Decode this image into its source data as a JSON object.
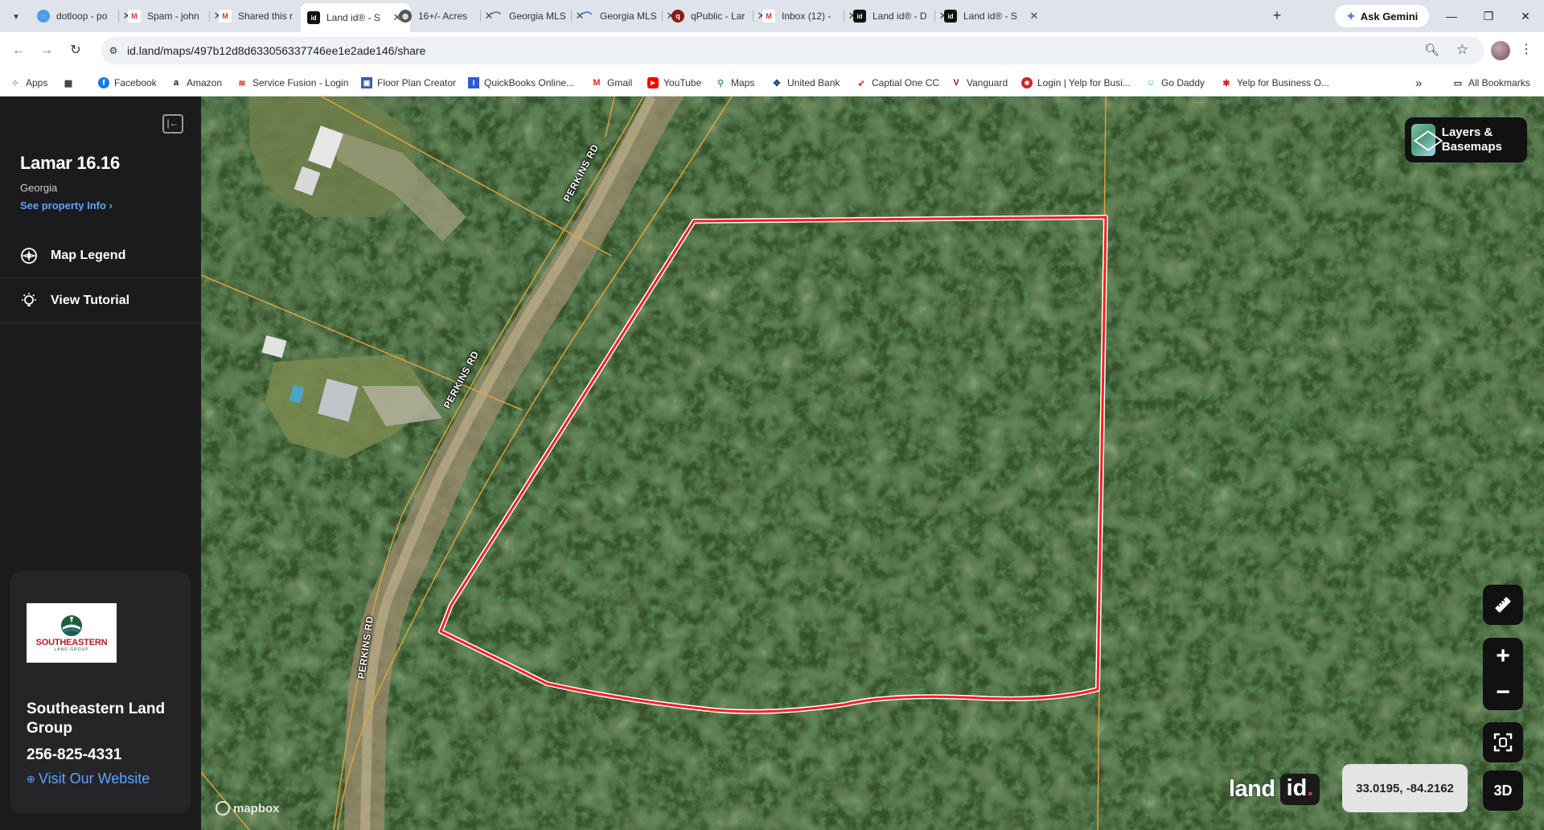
{
  "browser": {
    "tabs": [
      {
        "title": "dotloop - po",
        "favicon": "dotloop-icon",
        "color": "#4d9be8",
        "active": false
      },
      {
        "title": "Spam - john",
        "favicon": "gmail-icon",
        "color": "#d93025",
        "active": false
      },
      {
        "title": "Shared this r",
        "favicon": "gmail-icon",
        "color": "#d93025",
        "active": false
      },
      {
        "title": "Land id® - S",
        "favicon": "landid-icon",
        "color": "#111111",
        "active": true
      },
      {
        "title": "16+/- Acres",
        "favicon": "globe-icon",
        "color": "#555555",
        "active": false
      },
      {
        "title": "Georgia MLS",
        "favicon": "gamls-icon",
        "color": "#2a6cb3",
        "active": false
      },
      {
        "title": "Georgia MLS",
        "favicon": "gamls-icon",
        "color": "#2a6cb3",
        "active": false
      },
      {
        "title": "qPublic - Lar",
        "favicon": "qpublic-icon",
        "color": "#8b1b1b",
        "active": false
      },
      {
        "title": "Inbox (12) - ",
        "favicon": "gmail-icon",
        "color": "#d93025",
        "active": false
      },
      {
        "title": "Land id® - D",
        "favicon": "landid-icon",
        "color": "#111111",
        "active": false
      },
      {
        "title": "Land id® - S",
        "favicon": "landid-icon",
        "color": "#111111",
        "active": false
      }
    ],
    "new_tab_label": "+",
    "ask_gemini_label": "Ask Gemini",
    "url": "id.land/maps/497b12d8d633056337746ee1e2ade146/share",
    "bookmarks": [
      {
        "label": "Apps",
        "icon": "apps-grid-icon",
        "color": "#4285f4"
      },
      {
        "label": "",
        "icon": "apps-launcher-icon",
        "color": "#333333"
      },
      {
        "label": "Facebook",
        "icon": "facebook-icon",
        "color": "#1877f2"
      },
      {
        "label": "Amazon",
        "icon": "amazon-icon",
        "color": "#111111"
      },
      {
        "label": "Service Fusion - Login",
        "icon": "servicefusion-icon",
        "color": "#d9281f"
      },
      {
        "label": "Floor Plan Creator",
        "icon": "floorplan-icon",
        "color": "#3a5fa8"
      },
      {
        "label": "QuickBooks Online...",
        "icon": "quickbooks-icon",
        "color": "#2a5bd7"
      },
      {
        "label": "Gmail",
        "icon": "gmail-icon",
        "color": "#d93025"
      },
      {
        "label": "YouTube",
        "icon": "youtube-icon",
        "color": "#ff0000"
      },
      {
        "label": "Maps",
        "icon": "maps-pin-icon",
        "color": "#34a853"
      },
      {
        "label": "United Bank",
        "icon": "unitedbank-icon",
        "color": "#1c3f73"
      },
      {
        "label": "Captial One CC",
        "icon": "capitalone-icon",
        "color": "#d22e1e"
      },
      {
        "label": "Vanguard",
        "icon": "vanguard-icon",
        "color": "#96151d"
      },
      {
        "label": "Login | Yelp for Busi...",
        "icon": "yelp-icon",
        "color": "#d32323"
      },
      {
        "label": "Go Daddy",
        "icon": "godaddy-icon",
        "color": "#1bdbdb"
      },
      {
        "label": "Yelp for Business O...",
        "icon": "yelp-icon",
        "color": "#d32323"
      }
    ],
    "overflow_label": "»",
    "all_bookmarks_label": "All Bookmarks"
  },
  "sidebar": {
    "property_title": "Lamar 16.16",
    "state": "Georgia",
    "property_info_link": "See property Info  ›",
    "menu": [
      {
        "label": "Map Legend",
        "icon": "compass-icon"
      },
      {
        "label": "View Tutorial",
        "icon": "lightbulb-icon"
      }
    ],
    "agent": {
      "logo_name": "SOUTHEASTERN",
      "logo_sub": "LAND GROUP",
      "name": "Southeastern Land Group",
      "phone": "256-825-4331",
      "website_label": "Visit Our Website"
    }
  },
  "map": {
    "road_name": "PERKINS RD",
    "layers_button": "Layers & Basemaps",
    "coordinates": "33.0195, -84.2162",
    "three_d_label": "3D",
    "zoom_in": "+",
    "zoom_out": "−",
    "brand_word": "land",
    "brand_id": "id",
    "attribution": "mapbox",
    "parcel_color": "#ff1e1e",
    "parcel_line_color": "#e8a33a"
  }
}
